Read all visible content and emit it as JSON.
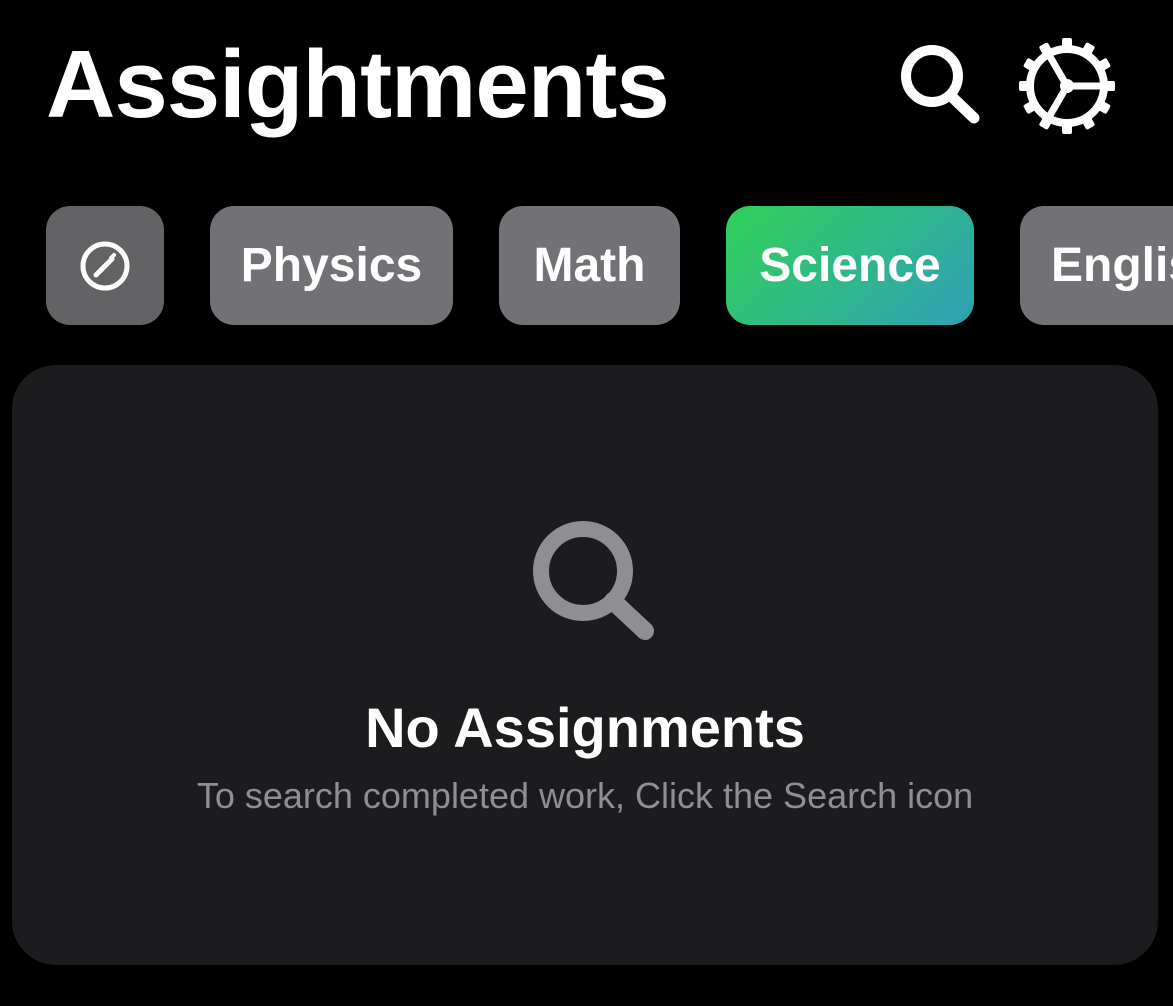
{
  "header": {
    "title": "Assightments",
    "search_icon": "search-icon",
    "settings_icon": "gear-icon"
  },
  "filters": {
    "edit_icon": "pencil-circle-icon",
    "chips": [
      {
        "label": "Physics",
        "selected": false
      },
      {
        "label": "Math",
        "selected": false
      },
      {
        "label": "Science",
        "selected": true
      },
      {
        "label": "Englis",
        "selected": false
      }
    ]
  },
  "empty_state": {
    "icon": "search-icon",
    "title": "No Assignments",
    "subtitle": "To search completed work, Click the Search icon"
  },
  "colors": {
    "background": "#000000",
    "chip": "#727276",
    "panel": "#1c1c1e",
    "selected_gradient_start": "#30d158",
    "selected_gradient_end": "#30a0b8",
    "muted_text": "#8e8e93"
  }
}
